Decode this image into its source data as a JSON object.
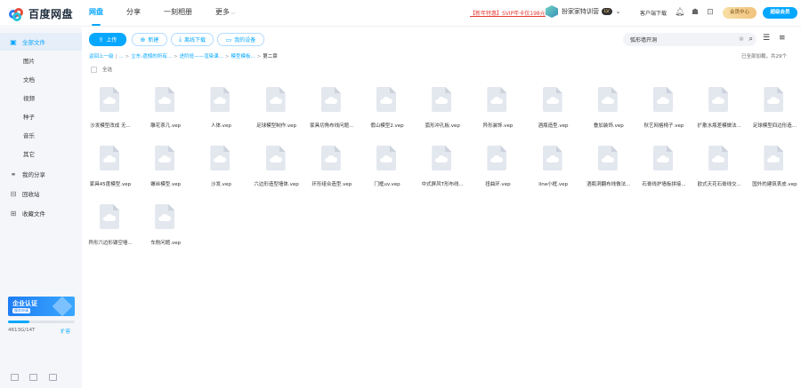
{
  "brand": {
    "name": "百度网盘"
  },
  "nav": [
    {
      "label": "网盘",
      "active": true
    },
    {
      "label": "分享",
      "active": false
    },
    {
      "label": "一刻相册",
      "active": false
    },
    {
      "label": "更多",
      "active": false
    }
  ],
  "header": {
    "promo": "【新年特惠】SVIP年卡仅198元",
    "username": "扮家家特训营",
    "vip_badge": "LV",
    "client_download": "客户端下载",
    "member_center": "会员中心",
    "upgrade": "超级会员"
  },
  "sidebar": {
    "items": [
      {
        "label": "全部文件",
        "icon": "folder-icon"
      },
      {
        "label": "图片"
      },
      {
        "label": "文档"
      },
      {
        "label": "视频"
      },
      {
        "label": "种子"
      },
      {
        "label": "音乐"
      },
      {
        "label": "其它"
      },
      {
        "label": "我的分享",
        "icon": "share-icon"
      },
      {
        "label": "回收站",
        "icon": "trash-icon"
      },
      {
        "label": "收藏文件",
        "icon": "star-icon"
      }
    ],
    "banner_title": "企业认证",
    "banner_sub": "服务申请",
    "quota_text": "4613G/14T",
    "quota_fraction": 0.32,
    "expand": "扩容"
  },
  "toolbar": {
    "upload": "上传",
    "new_folder": "新建",
    "offline": "离线下载",
    "my_devices": "我的设备",
    "search_value": "弧形墙开洞"
  },
  "breadcrumb": {
    "items": [
      "返回上一级",
      "...",
      "立东-遗憾的所有...",
      "进阶班——渲染课...",
      "模型模板..."
    ],
    "current": "第二章"
  },
  "load_info": "已全部加载，共29个",
  "select_all": "全选",
  "files": [
    "沙发模型改成 无...",
    "雕花茶几.vep",
    "人体.vep",
    "足球模型制作.vep",
    "家具切角布线问题...",
    "假山模型2.vep",
    "弧形冲孔板.vep",
    "异形装饰.vep",
    "酒瓶造型.vep",
    "叠加装饰.vep",
    "秋艺网格椅子.vep",
    "扩散水瓶差模做法...",
    "足球模型四边形造...",
    "家具45度模型.vep",
    "螺丝模型.vep",
    "沙发.vep",
    "六边形造型墙体.vep",
    "环形组合造型.vep",
    "门框uv.vep",
    "中式屏风T形布线...",
    "扭曲环.vep",
    "line小框.vep",
    "酒瓶洞翻布线做法...",
    "石膏线护墙板拼接...",
    "欧式天花石膏线交...",
    "国外的建筑表皮.vep",
    "异形六边形镂空墙...",
    "车削问题.vep"
  ]
}
